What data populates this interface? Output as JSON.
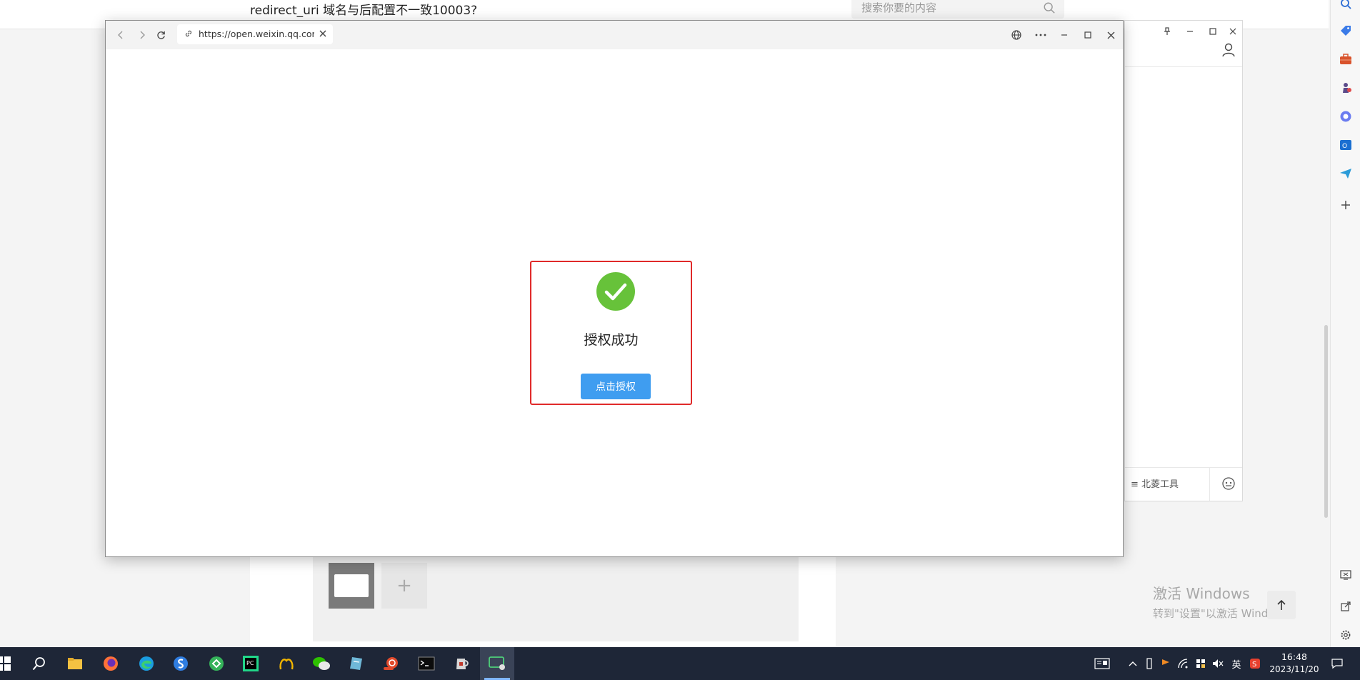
{
  "background": {
    "question_title": "redirect_uri 域名与后配置不一致10003?",
    "search_placeholder": "搜索你要的内容",
    "watermark_title": "激活 Windows",
    "watermark_subtitle": "转到\"设置\"以激活 Windows。",
    "side_panel_tools_label": "北菱工具"
  },
  "popup": {
    "url": "https://open.weixin.qq.com",
    "success_text": "授权成功",
    "auth_button_label": "点击授权"
  },
  "taskbar": {
    "ime_label": "英",
    "time": "16:48",
    "date": "2023/11/20"
  },
  "colors": {
    "success_green": "#67c23a",
    "primary_blue": "#3f9df0",
    "highlight_red": "#e02a2a",
    "taskbar_bg": "#1e2637"
  }
}
